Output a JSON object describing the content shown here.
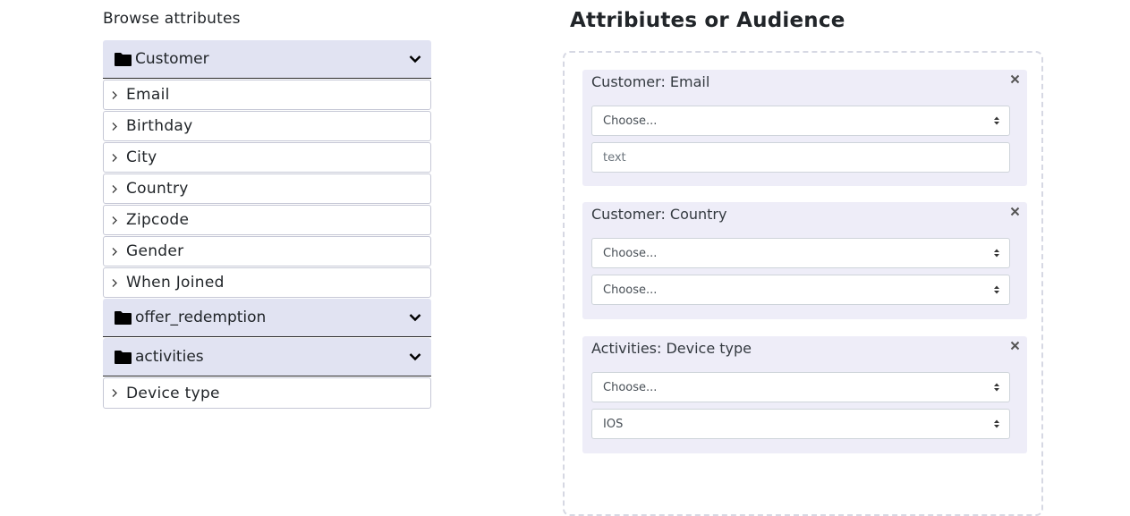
{
  "browse": {
    "title": "Browse attributes",
    "folders": [
      {
        "label": "Customer",
        "items": [
          "Email",
          "Birthday",
          "City",
          "Country",
          "Zipcode",
          "Gender",
          "When Joined"
        ]
      },
      {
        "label": "offer_redemption",
        "items": []
      },
      {
        "label": "activities",
        "items": [
          "Device type"
        ]
      }
    ]
  },
  "audience": {
    "title": "Attribiutes or Audience",
    "cards": [
      {
        "title": "Customer: Email",
        "operator": "Choose...",
        "value_placeholder": "text"
      },
      {
        "title": "Customer: Country",
        "operator": "Choose...",
        "value": "Choose..."
      },
      {
        "title": "Activities: Device type",
        "operator": "Choose...",
        "value": "IOS"
      }
    ]
  },
  "icons": {
    "folder": "folder-icon",
    "expand": "chevron-down-icon",
    "item": "chevron-right-icon",
    "remove": "close-icon",
    "select": "select-caret-icon"
  }
}
